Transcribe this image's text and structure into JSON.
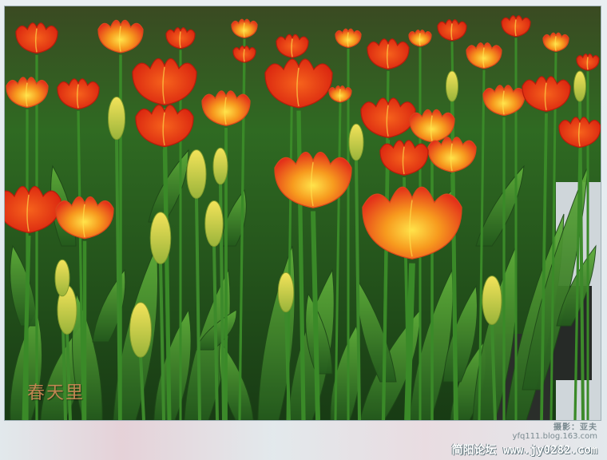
{
  "photo": {
    "subject": "tulip-field",
    "colors": {
      "petal_red": "#e8341a",
      "petal_orange": "#f47a18",
      "petal_yellow": "#ffd23a",
      "leaf_green": "#3f8f2a",
      "leaf_dark": "#1f4a18",
      "bud_yellow": "#d8d040"
    }
  },
  "overlay": {
    "caption": "春天里",
    "photographer_line": "摄影：亚夫",
    "photographer_url": "yfq111.blog.163.com",
    "forum_name": "简阳论坛",
    "forum_url": "www.jy0282.com"
  }
}
